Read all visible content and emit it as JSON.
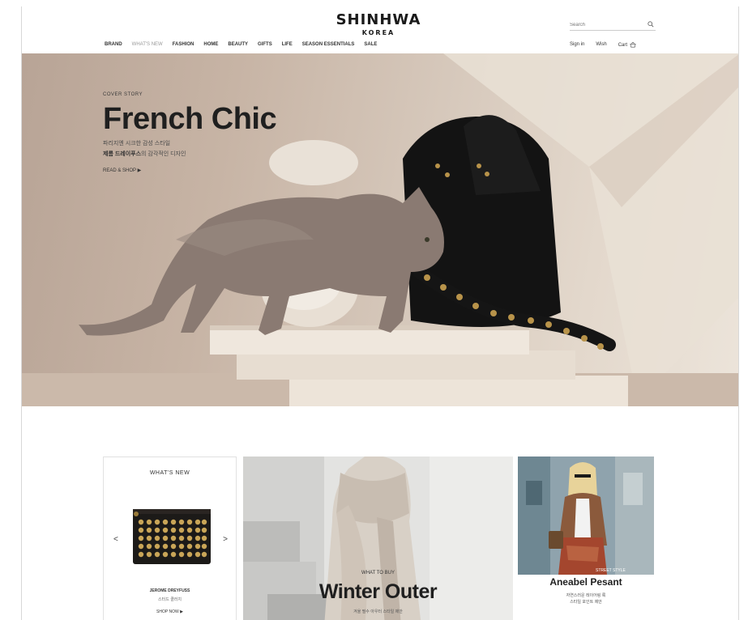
{
  "brand": {
    "name": "SHINHWA",
    "sub": "KOREA"
  },
  "nav": [
    "BRAND",
    "WHAT'S NEW",
    "FASHION",
    "HOME",
    "BEAUTY",
    "GIFTS",
    "LIFE",
    "SEASON ESSENTIALS",
    "SALE"
  ],
  "search": {
    "placeholder": "Search"
  },
  "utility": {
    "sign_in": "Sign in",
    "wish": "Wish",
    "cart": "Cart"
  },
  "hero": {
    "kicker": "COVER STORY",
    "title": "French Chic",
    "desc_line1": "파리지엔 시크한 감성 스타일",
    "desc_bold": "제롬 드레이푸스",
    "desc_line2_rest": "의 감각적인 디자인",
    "cta": "READ & SHOP ▶"
  },
  "whats_new": {
    "title": "WHAT'S NEW",
    "prev": "<",
    "next": ">",
    "product_name": "JEROME DREYFUSS",
    "product_sub": "스터드 클러치",
    "link": "SHOP NOW ▶"
  },
  "winter": {
    "kicker": "WHAT TO BUY",
    "title": "Winter Outer",
    "sub": "겨울 필수 아우터 스타일 제안"
  },
  "street": {
    "badge": "STREET STYLE",
    "name": "Aneabel Pesant",
    "desc1": "자연스러운 레이어링 룩",
    "desc2": "스타일 포인트 제안"
  },
  "colors": {
    "accent": "#1f1f1f",
    "hero_bg": "#c9b8a8",
    "bag": "#141414",
    "studs": "#b8934a",
    "cat": "#8a7a72"
  }
}
